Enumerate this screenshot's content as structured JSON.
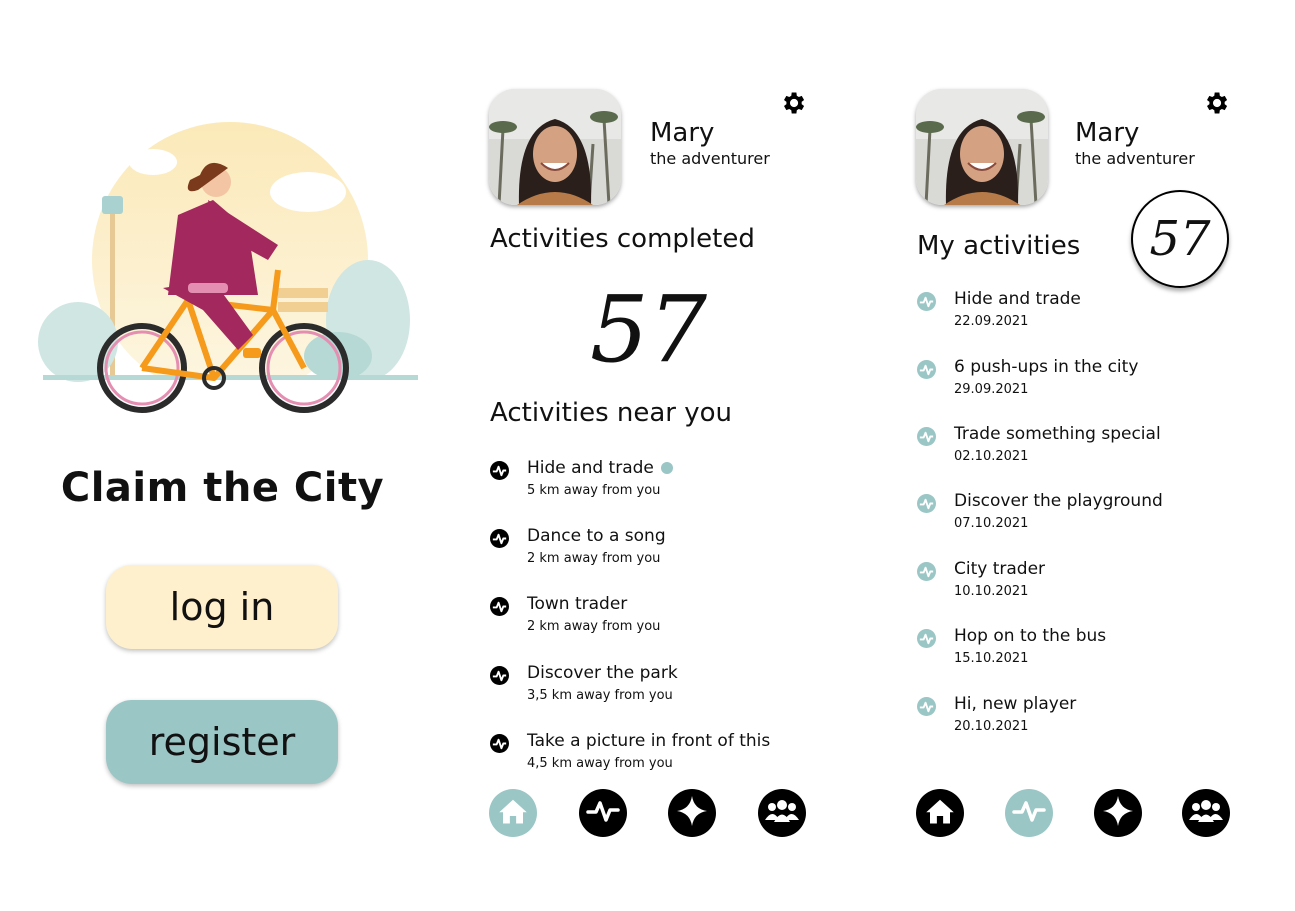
{
  "login_screen": {
    "app_title": "Claim the City",
    "login_label": "log in",
    "register_label": "register"
  },
  "home_screen": {
    "profile": {
      "name": "Mary",
      "title": "the adventurer"
    },
    "completed_heading": "Activities completed",
    "completed_count": "57",
    "nearby_heading": "Activities near you",
    "nearby": [
      {
        "name": "Hide and trade",
        "distance": "5 km away from you"
      },
      {
        "name": "Dance to a song",
        "distance": "2 km away from you"
      },
      {
        "name": "Town trader",
        "distance": "2 km away from you"
      },
      {
        "name": "Discover the park",
        "distance": "3,5 km away from you"
      },
      {
        "name": "Take a picture in front of this",
        "distance": "4,5 km away from you"
      }
    ]
  },
  "activities_screen": {
    "profile": {
      "name": "Mary",
      "title": "the adventurer"
    },
    "heading": "My activities",
    "count": "57",
    "items": [
      {
        "name": "Hide and trade",
        "date": "22.09.2021"
      },
      {
        "name": "6 push-ups in the city",
        "date": "29.09.2021"
      },
      {
        "name": "Trade something special",
        "date": "02.10.2021"
      },
      {
        "name": "Discover the playground",
        "date": "07.10.2021"
      },
      {
        "name": "City trader",
        "date": "10.10.2021"
      },
      {
        "name": "Hop on to the bus",
        "date": "15.10.2021"
      },
      {
        "name": "Hi, new player",
        "date": "20.10.2021"
      }
    ]
  },
  "colors": {
    "teal": "#9ac6c5",
    "cream": "#fef0cd",
    "dark": "#000000"
  },
  "icons": [
    "settings-gear-icon",
    "activity-pulse-icon",
    "home-icon",
    "plus-sparkle-icon",
    "group-icon"
  ]
}
